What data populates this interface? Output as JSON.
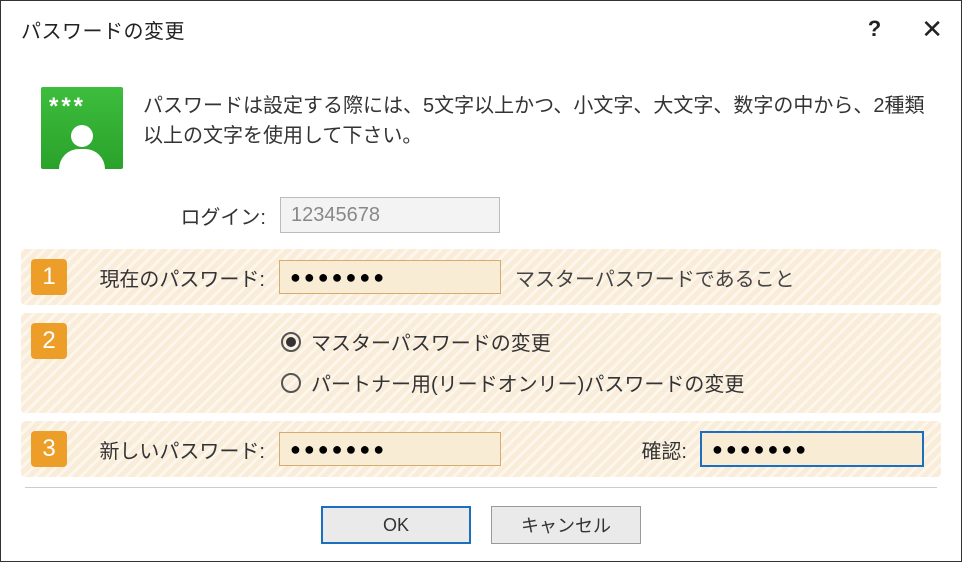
{
  "titlebar": {
    "title": "パスワードの変更",
    "help_glyph": "?",
    "close_glyph": "✕"
  },
  "icon": {
    "stars": "***"
  },
  "instructions": "パスワードは設定する際には、5文字以上かつ、小文字、大文字、数字の中から、2種類以上の文字を使用して下さい。",
  "login": {
    "label": "ログイン:",
    "value": "12345678"
  },
  "steps": {
    "s1": {
      "badge": "1",
      "label": "現在のパスワード:",
      "value": "●●●●●●●",
      "hint": "マスターパスワードであること"
    },
    "s2": {
      "badge": "2",
      "radio1": "マスターパスワードの変更",
      "radio2": "パートナー用(リードオンリー)パスワードの変更"
    },
    "s3": {
      "badge": "3",
      "label": "新しいパスワード:",
      "value": "●●●●●●●",
      "confirm_label": "確認:",
      "confirm_value": "●●●●●●●"
    }
  },
  "buttons": {
    "ok": "OK",
    "cancel": "キャンセル"
  }
}
